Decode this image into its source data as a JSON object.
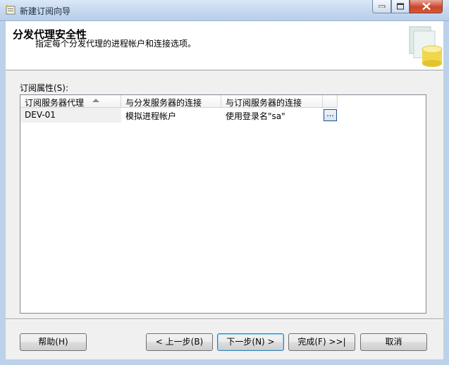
{
  "window": {
    "title": "新建订阅向导"
  },
  "header": {
    "title": "分发代理安全性",
    "subtitle": "指定每个分发代理的进程帐户和连接选项。"
  },
  "grid": {
    "label": "订阅属性(S):",
    "columns": [
      "订阅服务器代理",
      "与分发服务器的连接",
      "与订阅服务器的连接"
    ],
    "rows": [
      {
        "agent": "DEV-01",
        "distributor_conn": "模拟进程帐户",
        "subscriber_conn": "使用登录名\"sa\"",
        "button": "..."
      }
    ]
  },
  "buttons": {
    "help": "帮助(H)",
    "back": "< 上一步(B)",
    "next": "下一步(N) >",
    "finish": "完成(F) >>|",
    "cancel": "取消"
  }
}
